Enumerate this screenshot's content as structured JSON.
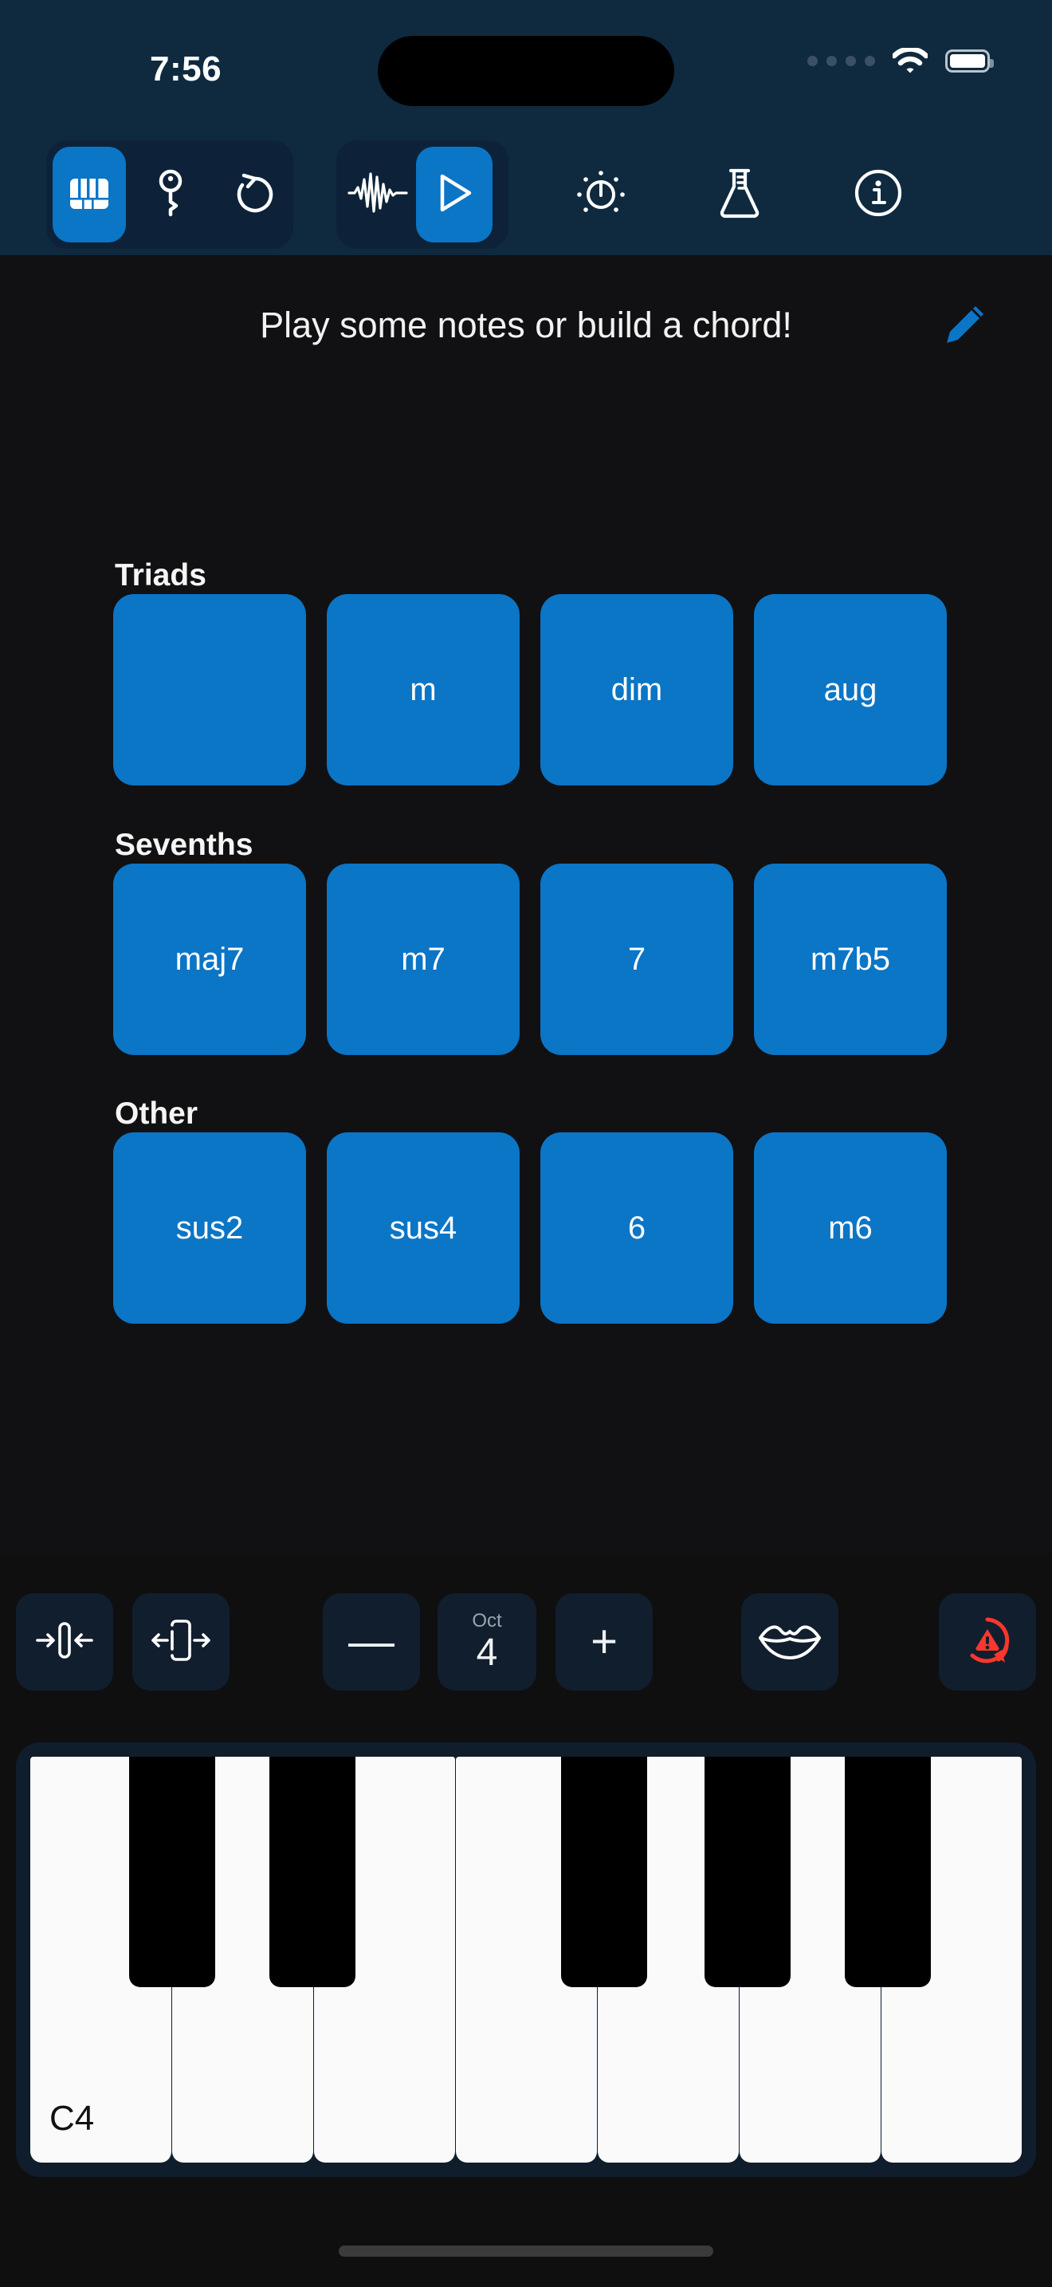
{
  "status_bar": {
    "time": "7:56",
    "signal_icon": "signal-dots-icon",
    "wifi_icon": "wifi-icon",
    "battery_icon": "battery-icon"
  },
  "toolbar": {
    "group_left": [
      {
        "name": "piano-keys",
        "icon": "piano-keys-icon",
        "active": true
      },
      {
        "name": "key-signature",
        "icon": "key-icon",
        "active": false
      },
      {
        "name": "undo",
        "icon": "undo-arrow-icon",
        "active": false
      }
    ],
    "group_middle": [
      {
        "name": "waveform",
        "icon": "waveform-icon",
        "active": false
      },
      {
        "name": "play",
        "icon": "play-triangle-icon",
        "active": true
      }
    ],
    "group_right": [
      {
        "name": "metronome",
        "icon": "tuner-dial-icon",
        "active": false
      },
      {
        "name": "lab",
        "icon": "flask-icon",
        "active": false
      },
      {
        "name": "info",
        "icon": "info-circle-icon",
        "active": false
      }
    ]
  },
  "header": {
    "message": "Play some notes or build a chord!",
    "edit_icon": "pencil-icon"
  },
  "chord_sections": [
    {
      "title": "Triads",
      "buttons": [
        {
          "label": ""
        },
        {
          "label": "m"
        },
        {
          "label": "dim"
        },
        {
          "label": "aug"
        }
      ]
    },
    {
      "title": "Sevenths",
      "buttons": [
        {
          "label": "maj7"
        },
        {
          "label": "m7"
        },
        {
          "label": "7"
        },
        {
          "label": "m7b5"
        }
      ]
    },
    {
      "title": "Other",
      "buttons": [
        {
          "label": "sus2"
        },
        {
          "label": "sus4"
        },
        {
          "label": "6"
        },
        {
          "label": "m6"
        }
      ]
    }
  ],
  "controls": {
    "narrow_keys": {
      "icon": "collapse-horizontal-icon"
    },
    "widen_keys": {
      "icon": "expand-horizontal-icon"
    },
    "octave_down": {
      "label": "—"
    },
    "octave": {
      "caption": "Oct",
      "value": "4"
    },
    "octave_up": {
      "label": "+"
    },
    "vocal": {
      "icon": "lips-icon"
    },
    "panic": {
      "icon": "alert-reset-icon"
    }
  },
  "keyboard": {
    "first_key_label": "C4",
    "white_keys": [
      "C4",
      "",
      "",
      "",
      "",
      "",
      ""
    ],
    "black_key_count": 5
  },
  "colors": {
    "accent_blue": "#0b75c6",
    "toolbar_bg": "#0f2a3f",
    "segment_bg": "#0d2238",
    "page_bg": "#111113",
    "panel_bg": "#101d2c",
    "alert_red": "#f8372d",
    "white_key": "#fafafa"
  }
}
